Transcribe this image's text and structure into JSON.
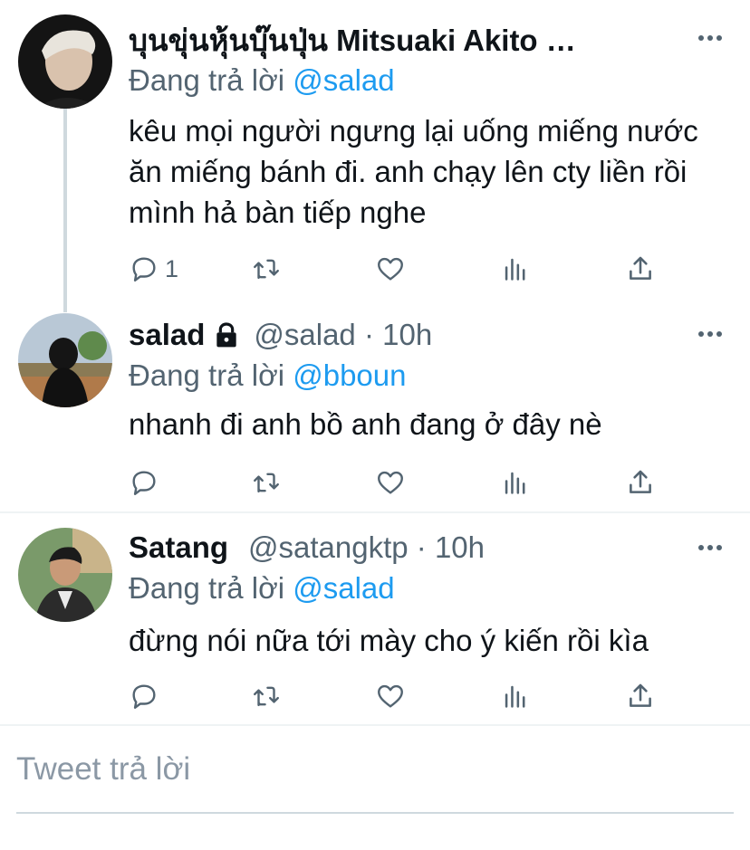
{
  "tweets": [
    {
      "name": "บุนขุ่นหุ้นบุ๊นปุ่น Mitsuaki Akito …",
      "meta": "",
      "replying_prefix": "Đang trả lời",
      "replying_to": "@salad",
      "text": "kêu mọi người ngưng lại uống miếng nước ăn miếng bánh đi. anh chạy lên cty liền rồi mình hả bàn tiếp nghe",
      "reply_count": "1"
    },
    {
      "name": "salad",
      "meta": "@salad · 10h",
      "locked": true,
      "replying_prefix": "Đang trả lời",
      "replying_to": "@bboun",
      "text": "nhanh đi anh bồ anh đang ở đây nè",
      "reply_count": ""
    },
    {
      "name": "Satang",
      "meta": "@satangktp · 10h",
      "replying_prefix": "Đang trả lời",
      "replying_to": "@salad",
      "text": "đừng nói nữa tới mày cho ý kiến rồi kìa",
      "reply_count": ""
    }
  ],
  "icons": [
    "reply-icon",
    "retweet-icon",
    "like-icon",
    "analytics-icon",
    "share-icon",
    "more-icon",
    "lock-icon"
  ],
  "colors": {
    "mention": "#1d9bf0",
    "secondary_text": "#536471",
    "icon": "#536471"
  },
  "compose": {
    "placeholder": "Tweet trả lời"
  }
}
